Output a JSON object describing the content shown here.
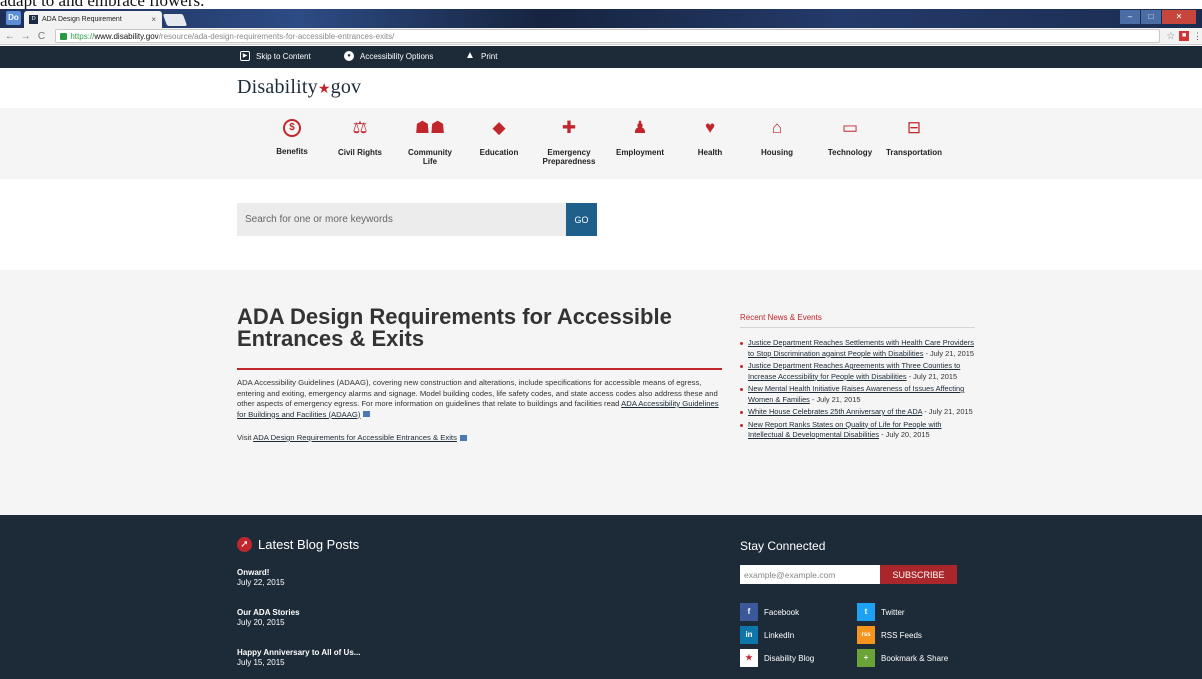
{
  "browser": {
    "caption": "adapt to and embrace flowers.",
    "tab_title": "ADA Design Requirement",
    "tab_close": "×",
    "app_button": "Do",
    "favicon_letter": "D",
    "url_scheme": "https://",
    "url_host": "www.disability.gov",
    "url_path": "/resource/ada-design-requirements-for-accessible-entrances-exits/"
  },
  "utility_bar": {
    "skip": "Skip to Content",
    "accessibility": "Accessibility Options",
    "print": "Print"
  },
  "logo": {
    "left": "Disability",
    "right": "gov"
  },
  "topics": [
    {
      "label": "Benefits",
      "icon": "dollar-icon"
    },
    {
      "label": "Civil Rights",
      "icon": "scales-icon"
    },
    {
      "label": "Community Life",
      "icon": "group-icon"
    },
    {
      "label": "Education",
      "icon": "graduation-cap-icon"
    },
    {
      "label": "Emergency Preparedness",
      "icon": "medical-cross-icon"
    },
    {
      "label": "Employment",
      "icon": "person-icon"
    },
    {
      "label": "Health",
      "icon": "heartbeat-icon"
    },
    {
      "label": "Housing",
      "icon": "house-icon"
    },
    {
      "label": "Technology",
      "icon": "monitor-icon"
    },
    {
      "label": "Transportation",
      "icon": "bus-icon"
    }
  ],
  "search": {
    "placeholder": "Search for one or more keywords",
    "button": "GO"
  },
  "article": {
    "title": "ADA Design Requirements for Accessible Entrances & Exits",
    "body_text": "ADA Accessibility Guidelines (ADAAG), covering new construction and alterations, include specifications for accessible means of egress, entering and exiting, emergency alarms and signage. Model building codes, life safety codes, and state access codes also address these and other aspects of emergency egress. For more information on guidelines that relate to buildings and facilities read",
    "body_link": "ADA Accessibility Guidelines for Buildings and Facilities (ADAAG)",
    "visit_prefix": "Visit",
    "visit_link": "ADA Design Requirements for Accessible Entrances & Exits"
  },
  "news": {
    "heading": "Recent News & Events",
    "items": [
      {
        "title": "Justice Department Reaches Settlements with Health Care Providers to Stop Discrimination against People with Disabilities",
        "date": "- July 21, 2015"
      },
      {
        "title": "Justice Department Reaches Agreements with Three Counties to Increase Accessibility for People with Disabilities",
        "date": "- July 21, 2015"
      },
      {
        "title": "New Mental Health Initiative Raises Awareness of Issues Affecting Women & Families",
        "date": "- July 21, 2015"
      },
      {
        "title": "White House Celebrates 25th Anniversary of the ADA",
        "date": "- July 21, 2015"
      },
      {
        "title": "New Report Ranks States on Quality of Life for People with Intellectual & Developmental Disabilities",
        "date": "- July 20, 2015"
      }
    ]
  },
  "footer": {
    "blog_heading": "Latest Blog Posts",
    "posts": [
      {
        "title": "Onward!",
        "date": "July 22, 2015"
      },
      {
        "title": "Our ADA Stories",
        "date": "July 20, 2015"
      },
      {
        "title": "Happy Anniversary to All of Us...",
        "date": "July 15, 2015"
      }
    ],
    "connect_heading": "Stay Connected",
    "email_placeholder": "example@example.com",
    "subscribe": "SUBSCRIBE",
    "social": [
      {
        "label": "Facebook",
        "glyph": "f",
        "color": "#3b5998",
        "icon": "facebook-icon"
      },
      {
        "label": "Twitter",
        "glyph": "t",
        "color": "#1da1f2",
        "icon": "twitter-icon"
      },
      {
        "label": "LinkedIn",
        "glyph": "in",
        "color": "#0e76a8",
        "icon": "linkedin-icon"
      },
      {
        "label": "RSS Feeds",
        "glyph": "rss",
        "color": "#f7941e",
        "icon": "rss-icon"
      },
      {
        "label": "Disability Blog",
        "glyph": "★",
        "color": "#ffffff",
        "icon": "blog-star-icon"
      },
      {
        "label": "Bookmark & Share",
        "glyph": "+",
        "color": "#6aa436",
        "icon": "bookmark-icon"
      }
    ]
  },
  "colors": {
    "brand_navy": "#1d2b38",
    "brand_red": "#c0272d",
    "button_blue": "#1e5f8c",
    "subscribe_red": "#a9262b"
  }
}
